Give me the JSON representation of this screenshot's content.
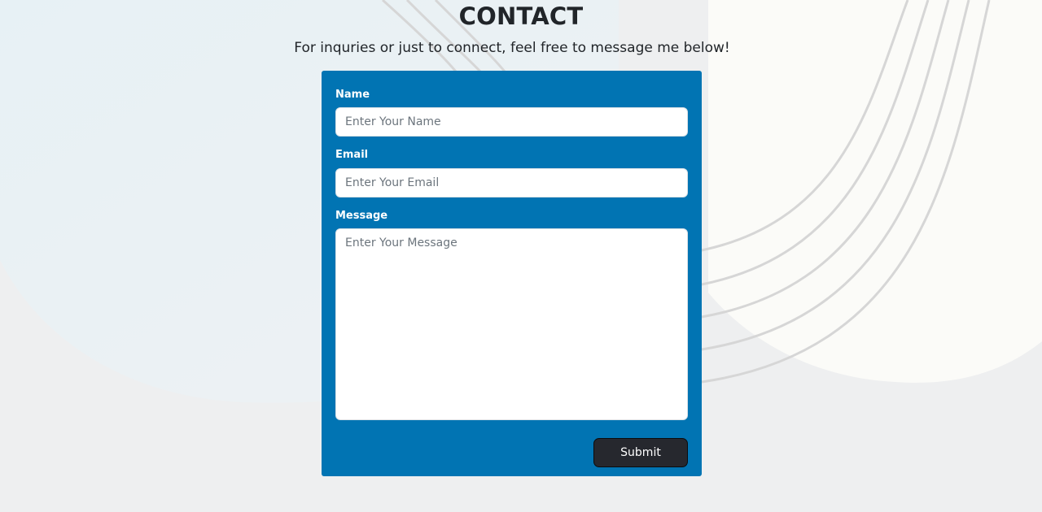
{
  "header": {
    "title": "CONTACT",
    "subtitle": "For inquries or just to connect, feel free to message me below!"
  },
  "form": {
    "name": {
      "label": "Name",
      "placeholder": "Enter Your Name",
      "value": ""
    },
    "email": {
      "label": "Email",
      "placeholder": "Enter Your Email",
      "value": ""
    },
    "message": {
      "label": "Message",
      "placeholder": "Enter Your Message",
      "value": ""
    },
    "submit_label": "Submit"
  },
  "colors": {
    "card_background": "#0174b3",
    "submit_background": "#26282e",
    "text_dark": "#212529",
    "page_background": "#eeeff0"
  }
}
